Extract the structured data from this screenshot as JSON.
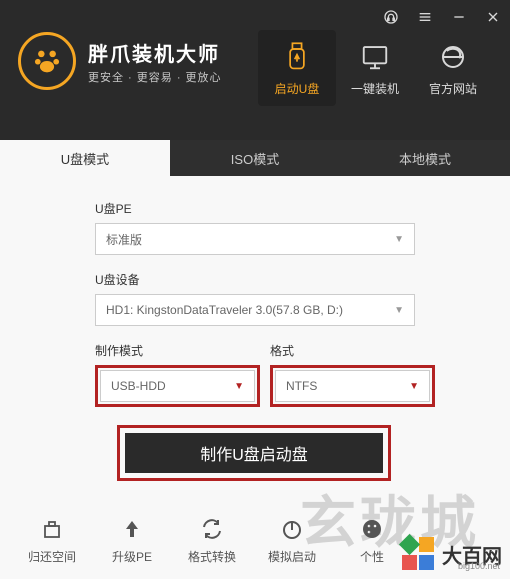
{
  "brand": {
    "title": "胖爪装机大师",
    "subtitle": "更安全 · 更容易 · 更放心"
  },
  "nav": {
    "usb": "启动U盘",
    "oneclick": "一键装机",
    "site": "官方网站"
  },
  "tabs": {
    "u": "U盘模式",
    "iso": "ISO模式",
    "local": "本地模式"
  },
  "form": {
    "pe_label": "U盘PE",
    "pe_value": "标准版",
    "device_label": "U盘设备",
    "device_value": "HD1: KingstonDataTraveler 3.0(57.8 GB, D:)",
    "mode_label": "制作模式",
    "mode_value": "USB-HDD",
    "format_label": "格式",
    "format_value": "NTFS",
    "make_button": "制作U盘启动盘"
  },
  "tools": {
    "restore": "归还空间",
    "upgrade": "升级PE",
    "convert": "格式转换",
    "simboot": "模拟启动",
    "personal": "个性"
  },
  "watermark": {
    "big": "大百网",
    "url": "big100.net",
    "bg": "玄珑城"
  }
}
